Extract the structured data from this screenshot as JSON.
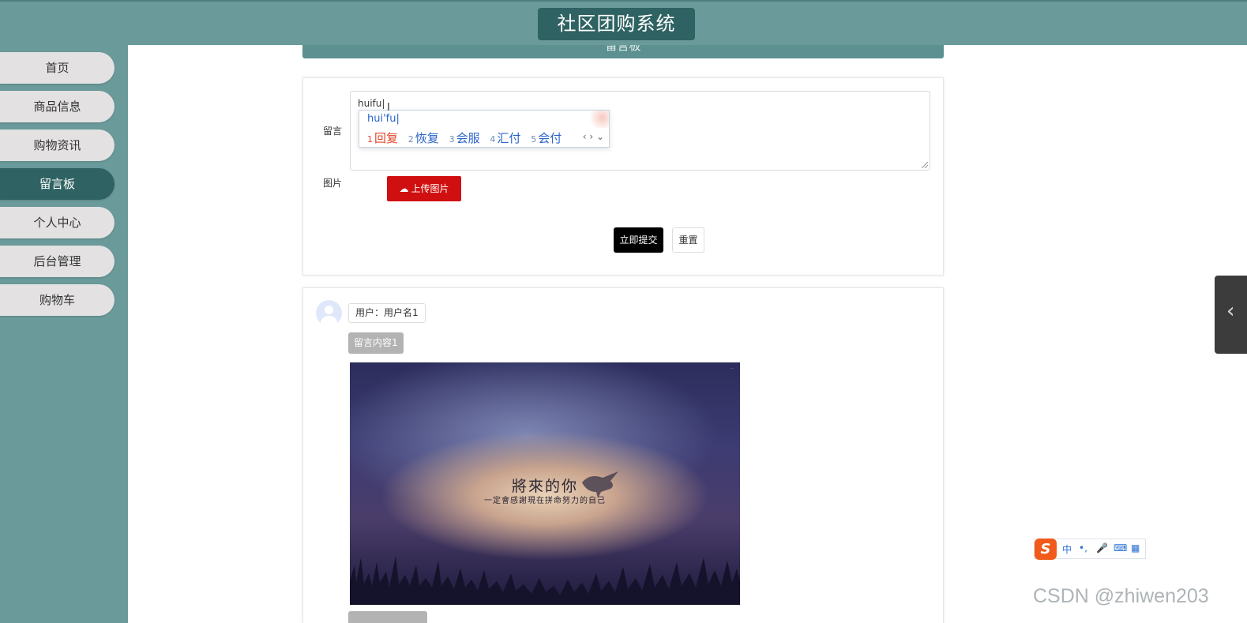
{
  "header": {
    "title": "社区团购系统"
  },
  "sidebar": {
    "items": [
      {
        "label": "首页"
      },
      {
        "label": "商品信息"
      },
      {
        "label": "购物资讯"
      },
      {
        "label": "留言板",
        "active": true
      },
      {
        "label": "个人中心"
      },
      {
        "label": "后台管理"
      },
      {
        "label": "购物车"
      }
    ]
  },
  "page": {
    "section_title": "留言板"
  },
  "form": {
    "message_label": "留言",
    "message_value": "huifu",
    "image_label": "图片",
    "upload_label": "上传图片",
    "submit_label": "立即提交",
    "reset_label": "重置"
  },
  "ime": {
    "input": "hui'fu",
    "candidates": [
      {
        "num": "1",
        "text": "回复"
      },
      {
        "num": "2",
        "text": "恢复"
      },
      {
        "num": "3",
        "text": "会服"
      },
      {
        "num": "4",
        "text": "汇付"
      },
      {
        "num": "5",
        "text": "会付"
      }
    ],
    "nav": "‹ › ⌄"
  },
  "messages": [
    {
      "user_label": "用户：用户名1",
      "content": "留言内容1",
      "image": {
        "title": "將來的你",
        "subtitle": "一定會感謝現在拼命努力的自己"
      }
    }
  ],
  "ime_toolbar": {
    "logo": "S",
    "lang": "中",
    "punct": "•,",
    "mic": "🎤",
    "keyboard": "⌨",
    "apps": "▦"
  },
  "watermark": "CSDN @zhiwen203",
  "colors": {
    "teal": "#6a9a9a",
    "teal_dark": "#2f6262",
    "upload_red": "#d01010",
    "submit_black": "#000000"
  }
}
